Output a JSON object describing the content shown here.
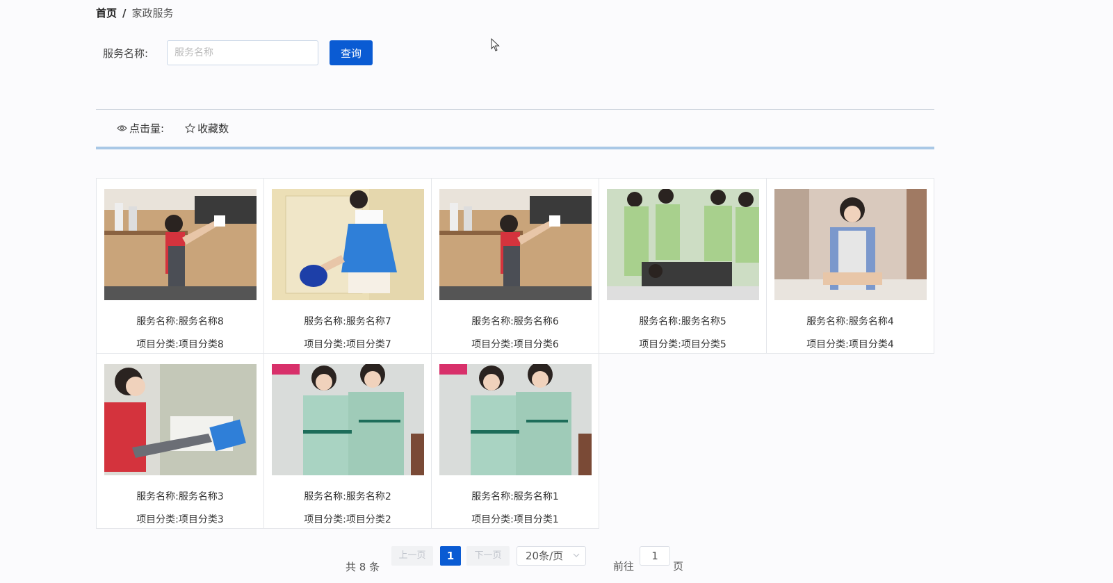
{
  "breadcrumb": {
    "home": "首页",
    "separator": "/",
    "current": "家政服务"
  },
  "search": {
    "label": "服务名称:",
    "placeholder": "服务名称",
    "value": "",
    "button": "查询"
  },
  "sort": {
    "clicks_label": "点击量:",
    "favorites_label": "收藏数"
  },
  "colors": {
    "primary": "#0a5bd3",
    "divider": "#a9c8e6"
  },
  "items": [
    {
      "name": "服务名称:服务名称8",
      "category": "项目分类:项目分类8",
      "image": "kitchen-cleaner"
    },
    {
      "name": "服务名称:服务名称7",
      "category": "项目分类:项目分类7",
      "image": "wall-wiper"
    },
    {
      "name": "服务名称:服务名称6",
      "category": "项目分类:项目分类6",
      "image": "kitchen-cleaner"
    },
    {
      "name": "服务名称:服务名称5",
      "category": "项目分类:项目分类5",
      "image": "training-group"
    },
    {
      "name": "服务名称:服务名称4",
      "category": "项目分类:项目分类4",
      "image": "maid-apron"
    },
    {
      "name": "服务名称:服务名称3",
      "category": "项目分类:项目分类3",
      "image": "window-cleaner"
    },
    {
      "name": "服务名称:服务名称2",
      "category": "项目分类:项目分类2",
      "image": "uniform-pair"
    },
    {
      "name": "服务名称:服务名称1",
      "category": "项目分类:项目分类1",
      "image": "uniform-pair"
    }
  ],
  "pagination": {
    "total_text": "共 8 条",
    "prev": "上一页",
    "current_page": "1",
    "next": "下一页",
    "page_size": "20条/页",
    "goto_label": "前往",
    "goto_value": "1",
    "goto_unit": "页"
  }
}
